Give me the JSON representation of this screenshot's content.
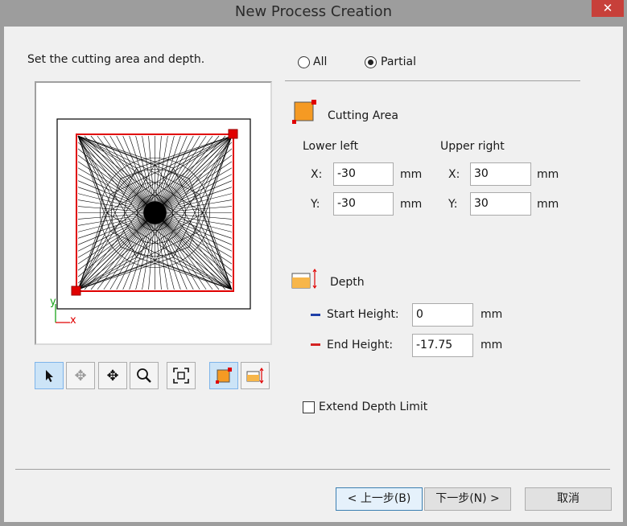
{
  "window": {
    "title": "New Process Creation",
    "close_label": "✕"
  },
  "instruction": "Set the cutting area and depth.",
  "scope": {
    "options": [
      "All",
      "Partial"
    ],
    "selected": "Partial"
  },
  "preview": {
    "axis_y": "y",
    "axis_x": "x"
  },
  "cutting_area": {
    "heading": "Cutting Area",
    "lower_left": {
      "label": "Lower left",
      "x_label": "X:",
      "x": "-30",
      "y_label": "Y:",
      "y": "-30",
      "unit": "mm"
    },
    "upper_right": {
      "label": "Upper right",
      "x_label": "X:",
      "x": "30",
      "y_label": "Y:",
      "y": "30",
      "unit": "mm"
    }
  },
  "depth": {
    "heading": "Depth",
    "start": {
      "label": "Start Height:",
      "value": "0",
      "unit": "mm",
      "color": "#1f3fa8"
    },
    "end": {
      "label": "End Height:",
      "value": "-17.75",
      "unit": "mm",
      "color": "#d42222"
    }
  },
  "extend_depth": {
    "label": "Extend Depth Limit",
    "checked": false
  },
  "toolbar": [
    "select-arrow-icon",
    "rotate-view-icon",
    "pan-icon",
    "zoom-icon",
    "fit-icon",
    "cutting-area-icon",
    "depth-icon"
  ],
  "buttons": {
    "back": "< 上一步(B)",
    "next": "下一步(N) >",
    "cancel": "取消"
  }
}
